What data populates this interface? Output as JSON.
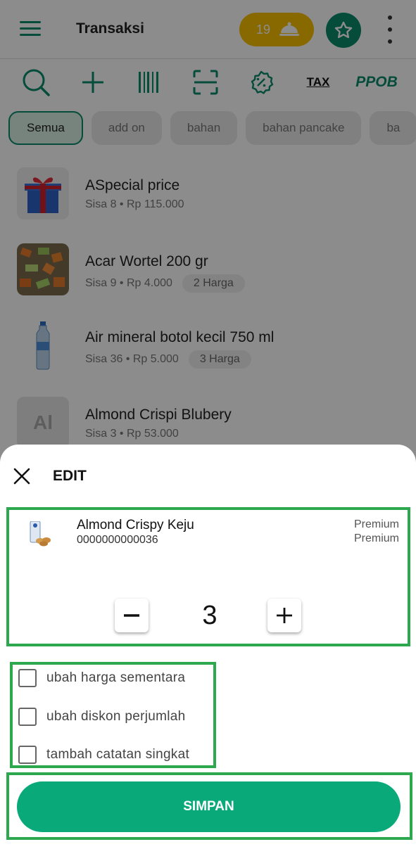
{
  "header": {
    "title": "Transaksi",
    "order_count": "19",
    "menu_icon": "hamburger-icon",
    "cloche_icon": "cloche-icon",
    "star_icon": "star-icon",
    "more_icon": "more-vertical-icon"
  },
  "toolbar": {
    "search_icon": "search-icon",
    "add_icon": "plus-icon",
    "barcode_icon": "barcode-icon",
    "scan_icon": "scan-icon",
    "discount_icon": "discount-icon",
    "tax_label": "TAX",
    "ppob_label": "PPOB"
  },
  "categories": [
    "Semua",
    "add on",
    "bahan",
    "bahan pancake",
    "ba"
  ],
  "products": [
    {
      "name": "ASpecial price",
      "stock": "Sisa 8",
      "price": "Rp 115.000",
      "tag": ""
    },
    {
      "name": "Acar Wortel 200 gr",
      "stock": "Sisa 9",
      "price": "Rp 4.000",
      "tag": "2 Harga"
    },
    {
      "name": "Air mineral botol kecil 750 ml",
      "stock": "Sisa 36",
      "price": "Rp 5.000",
      "tag": "3 Harga"
    },
    {
      "name": "Almond Crispi Blubery",
      "stock": "Sisa 3",
      "price": "Rp 53.000",
      "tag": "",
      "initials": "Al"
    }
  ],
  "sheet": {
    "title": "EDIT",
    "item": {
      "name": "Almond Crispy Keju",
      "code": "0000000000036",
      "tier1": "Premium",
      "tier2": "Premium",
      "quantity": "3"
    },
    "options": [
      "ubah harga sementara",
      "ubah diskon perjumlah",
      "tambah catatan singkat"
    ],
    "save_label": "SIMPAN"
  },
  "colors": {
    "brand": "#0a8a6a",
    "save_button": "#0aa97a",
    "badge": "#f6c000",
    "highlight_border": "#2ea84f"
  }
}
